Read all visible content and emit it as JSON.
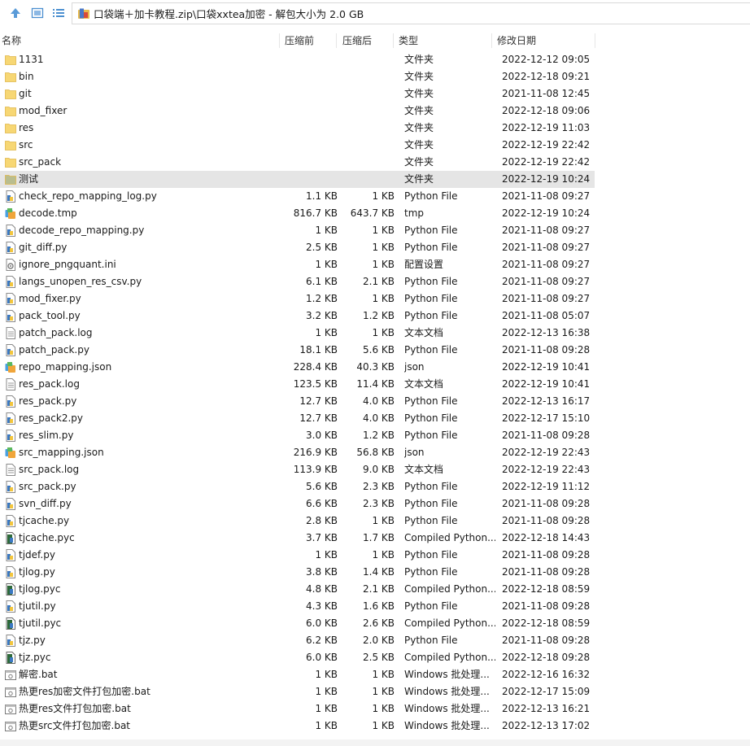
{
  "window": {
    "path": "口袋端＋加卡教程.zip\\口袋xxtea加密 - 解包大小为 2.0 GB"
  },
  "columns": {
    "name": "名称",
    "size": "压缩前",
    "packed": "压缩后",
    "type": "类型",
    "modified": "修改日期"
  },
  "files": [
    {
      "name": "1131",
      "size": "",
      "packed": "",
      "type": "文件夹",
      "modified": "2022-12-12 09:05",
      "icon": "folder-icon"
    },
    {
      "name": "bin",
      "size": "",
      "packed": "",
      "type": "文件夹",
      "modified": "2022-12-18 09:21",
      "icon": "folder-icon"
    },
    {
      "name": "git",
      "size": "",
      "packed": "",
      "type": "文件夹",
      "modified": "2021-11-08 12:45",
      "icon": "folder-icon"
    },
    {
      "name": "mod_fixer",
      "size": "",
      "packed": "",
      "type": "文件夹",
      "modified": "2022-12-18 09:06",
      "icon": "folder-icon"
    },
    {
      "name": "res",
      "size": "",
      "packed": "",
      "type": "文件夹",
      "modified": "2022-12-19 11:03",
      "icon": "folder-icon"
    },
    {
      "name": "src",
      "size": "",
      "packed": "",
      "type": "文件夹",
      "modified": "2022-12-19 22:42",
      "icon": "folder-icon"
    },
    {
      "name": "src_pack",
      "size": "",
      "packed": "",
      "type": "文件夹",
      "modified": "2022-12-19 22:42",
      "icon": "folder-icon"
    },
    {
      "name": "测试",
      "size": "",
      "packed": "",
      "type": "文件夹",
      "modified": "2022-12-19 10:24",
      "icon": "folder-icon",
      "selected": true
    },
    {
      "name": "check_repo_mapping_log.py",
      "size": "1.1 KB",
      "packed": "1 KB",
      "type": "Python File",
      "modified": "2021-11-08 09:27",
      "icon": "python-file-icon"
    },
    {
      "name": "decode.tmp",
      "size": "816.7 KB",
      "packed": "643.7 KB",
      "type": "tmp",
      "modified": "2022-12-19 10:24",
      "icon": "data-file-icon"
    },
    {
      "name": "decode_repo_mapping.py",
      "size": "1 KB",
      "packed": "1 KB",
      "type": "Python File",
      "modified": "2021-11-08 09:27",
      "icon": "python-file-icon"
    },
    {
      "name": "git_diff.py",
      "size": "2.5 KB",
      "packed": "1 KB",
      "type": "Python File",
      "modified": "2021-11-08 09:27",
      "icon": "python-file-icon"
    },
    {
      "name": "ignore_pngquant.ini",
      "size": "1 KB",
      "packed": "1 KB",
      "type": "配置设置",
      "modified": "2021-11-08 09:27",
      "icon": "ini-file-icon"
    },
    {
      "name": "langs_unopen_res_csv.py",
      "size": "6.1 KB",
      "packed": "2.1 KB",
      "type": "Python File",
      "modified": "2021-11-08 09:27",
      "icon": "python-file-icon"
    },
    {
      "name": "mod_fixer.py",
      "size": "1.2 KB",
      "packed": "1 KB",
      "type": "Python File",
      "modified": "2021-11-08 09:27",
      "icon": "python-file-icon"
    },
    {
      "name": "pack_tool.py",
      "size": "3.2 KB",
      "packed": "1.2 KB",
      "type": "Python File",
      "modified": "2021-11-08 05:07",
      "icon": "python-file-icon"
    },
    {
      "name": "patch_pack.log",
      "size": "1 KB",
      "packed": "1 KB",
      "type": "文本文档",
      "modified": "2022-12-13 16:38",
      "icon": "text-file-icon"
    },
    {
      "name": "patch_pack.py",
      "size": "18.1 KB",
      "packed": "5.6 KB",
      "type": "Python File",
      "modified": "2021-11-08 09:28",
      "icon": "python-file-icon"
    },
    {
      "name": "repo_mapping.json",
      "size": "228.4 KB",
      "packed": "40.3 KB",
      "type": "json",
      "modified": "2022-12-19 10:41",
      "icon": "data-file-icon"
    },
    {
      "name": "res_pack.log",
      "size": "123.5 KB",
      "packed": "11.4 KB",
      "type": "文本文档",
      "modified": "2022-12-19 10:41",
      "icon": "text-file-icon"
    },
    {
      "name": "res_pack.py",
      "size": "12.7 KB",
      "packed": "4.0 KB",
      "type": "Python File",
      "modified": "2022-12-13 16:17",
      "icon": "python-file-icon"
    },
    {
      "name": "res_pack2.py",
      "size": "12.7 KB",
      "packed": "4.0 KB",
      "type": "Python File",
      "modified": "2022-12-17 15:10",
      "icon": "python-file-icon"
    },
    {
      "name": "res_slim.py",
      "size": "3.0 KB",
      "packed": "1.2 KB",
      "type": "Python File",
      "modified": "2021-11-08 09:28",
      "icon": "python-file-icon"
    },
    {
      "name": "src_mapping.json",
      "size": "216.9 KB",
      "packed": "56.8 KB",
      "type": "json",
      "modified": "2022-12-19 22:43",
      "icon": "data-file-icon"
    },
    {
      "name": "src_pack.log",
      "size": "113.9 KB",
      "packed": "9.0 KB",
      "type": "文本文档",
      "modified": "2022-12-19 22:43",
      "icon": "text-file-icon"
    },
    {
      "name": "src_pack.py",
      "size": "5.6 KB",
      "packed": "2.3 KB",
      "type": "Python File",
      "modified": "2022-12-19 11:12",
      "icon": "python-file-icon"
    },
    {
      "name": "svn_diff.py",
      "size": "6.6 KB",
      "packed": "2.3 KB",
      "type": "Python File",
      "modified": "2021-11-08 09:28",
      "icon": "python-file-icon"
    },
    {
      "name": "tjcache.py",
      "size": "2.8 KB",
      "packed": "1 KB",
      "type": "Python File",
      "modified": "2021-11-08 09:28",
      "icon": "python-file-icon"
    },
    {
      "name": "tjcache.pyc",
      "size": "3.7 KB",
      "packed": "1.7 KB",
      "type": "Compiled Python...",
      "modified": "2022-12-18 14:43",
      "icon": "compiled-python-icon"
    },
    {
      "name": "tjdef.py",
      "size": "1 KB",
      "packed": "1 KB",
      "type": "Python File",
      "modified": "2021-11-08 09:28",
      "icon": "python-file-icon"
    },
    {
      "name": "tjlog.py",
      "size": "3.8 KB",
      "packed": "1.4 KB",
      "type": "Python File",
      "modified": "2021-11-08 09:28",
      "icon": "python-file-icon"
    },
    {
      "name": "tjlog.pyc",
      "size": "4.8 KB",
      "packed": "2.1 KB",
      "type": "Compiled Python...",
      "modified": "2022-12-18 08:59",
      "icon": "compiled-python-icon"
    },
    {
      "name": "tjutil.py",
      "size": "4.3 KB",
      "packed": "1.6 KB",
      "type": "Python File",
      "modified": "2021-11-08 09:28",
      "icon": "python-file-icon"
    },
    {
      "name": "tjutil.pyc",
      "size": "6.0 KB",
      "packed": "2.6 KB",
      "type": "Compiled Python...",
      "modified": "2022-12-18 08:59",
      "icon": "compiled-python-icon"
    },
    {
      "name": "tjz.py",
      "size": "6.2 KB",
      "packed": "2.0 KB",
      "type": "Python File",
      "modified": "2021-11-08 09:28",
      "icon": "python-file-icon"
    },
    {
      "name": "tjz.pyc",
      "size": "6.0 KB",
      "packed": "2.5 KB",
      "type": "Compiled Python...",
      "modified": "2022-12-18 09:28",
      "icon": "compiled-python-icon"
    },
    {
      "name": "解密.bat",
      "size": "1 KB",
      "packed": "1 KB",
      "type": "Windows 批处理...",
      "modified": "2022-12-16 16:32",
      "icon": "batch-file-icon"
    },
    {
      "name": "热更res加密文件打包加密.bat",
      "size": "1 KB",
      "packed": "1 KB",
      "type": "Windows 批处理...",
      "modified": "2022-12-17 15:09",
      "icon": "batch-file-icon"
    },
    {
      "name": "热更res文件打包加密.bat",
      "size": "1 KB",
      "packed": "1 KB",
      "type": "Windows 批处理...",
      "modified": "2022-12-13 16:21",
      "icon": "batch-file-icon"
    },
    {
      "name": "热更src文件打包加密.bat",
      "size": "1 KB",
      "packed": "1 KB",
      "type": "Windows 批处理...",
      "modified": "2022-12-13 17:02",
      "icon": "batch-file-icon"
    }
  ],
  "colors": {
    "folder": "#f7d774",
    "folder_selected": "#b9bd8f",
    "accent": "#3c8fd6",
    "selected_row": "#e5e5e5"
  }
}
